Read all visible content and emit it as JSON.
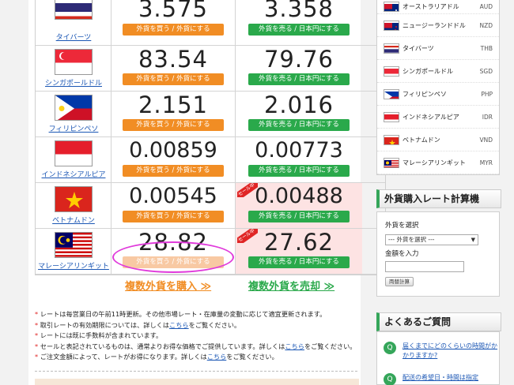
{
  "rates": [
    {
      "name": "タイバーツ",
      "buy": "3.575",
      "sell": "3.358",
      "sale": false,
      "buy_disabled": false
    },
    {
      "name": "シンガポールドル",
      "buy": "83.54",
      "sell": "79.76",
      "sale": false,
      "buy_disabled": false
    },
    {
      "name": "フィリピンペソ",
      "buy": "2.151",
      "sell": "2.016",
      "sale": false,
      "buy_disabled": false
    },
    {
      "name": "インドネシアルピア",
      "buy": "0.00859",
      "sell": "0.00773",
      "sale": false,
      "buy_disabled": false
    },
    {
      "name": "ベトナムドン",
      "buy": "0.00545",
      "sell": "0.00488",
      "sale": true,
      "buy_disabled": false
    },
    {
      "name": "マレーシアリンギット",
      "buy": "28.82",
      "sell": "27.62",
      "sale": true,
      "buy_disabled": true
    }
  ],
  "buttons": {
    "buy_label": "外貨を買う / 外貨にする",
    "sell_label": "外貨を売る / 日本円にする",
    "sale_tag": "セール中",
    "multi_buy": "複数外貨を購入 ≫",
    "multi_sell": "複数外貨を売却 ≫"
  },
  "notes": [
    {
      "text": "レートは毎営業日の午前11時更新。その他市場レート・在庫量の変動に応じて適宜更新されます。",
      "link": "",
      "after": ""
    },
    {
      "text": "取引レートの有効期限については、詳しくは",
      "link": "こちら",
      "after": "をご覧ください。"
    },
    {
      "text": "レートには既に手数料が含まれています。",
      "link": "",
      "after": ""
    },
    {
      "text": "セールと表記されているものは、通常よりお得な価格でご提供しています。詳しくは",
      "link": "こちら",
      "after": "をご覧ください。"
    },
    {
      "text": "ご注文金額によって、レートがお得になります。詳しくは",
      "link": "こちら",
      "after": "をご覧ください。"
    }
  ],
  "sidebar": {
    "currencies": [
      {
        "name": "オーストラリアドル",
        "code": "AUD"
      },
      {
        "name": "ニュージーランドドル",
        "code": "NZD"
      },
      {
        "name": "タイバーツ",
        "code": "THB"
      },
      {
        "name": "シンガポールドル",
        "code": "SGD"
      },
      {
        "name": "フィリピンペソ",
        "code": "PHP"
      },
      {
        "name": "インドネシアルピア",
        "code": "IDR"
      },
      {
        "name": "ベトナムドン",
        "code": "VND"
      },
      {
        "name": "マレーシアリンギット",
        "code": "MYR"
      }
    ],
    "calc_title": "外貨購入レート計算機",
    "calc_currency_label": "外貨を選択",
    "calc_select_value": "--- 外貨を選択 ---",
    "calc_amount_label": "金額を入力",
    "calc_button": "両替計算",
    "faq_title": "よくあるご質問",
    "faq": [
      {
        "q": "届くまでにどのくらいの時間がかかりますか?"
      },
      {
        "q": "配送の希望日・時間は指定"
      }
    ]
  },
  "colors": {
    "buy": "#f18d24",
    "sell": "#2aa94b",
    "sale_bg": "#fde3e3",
    "accent_green": "#35a65a",
    "link": "#1a56b4"
  }
}
